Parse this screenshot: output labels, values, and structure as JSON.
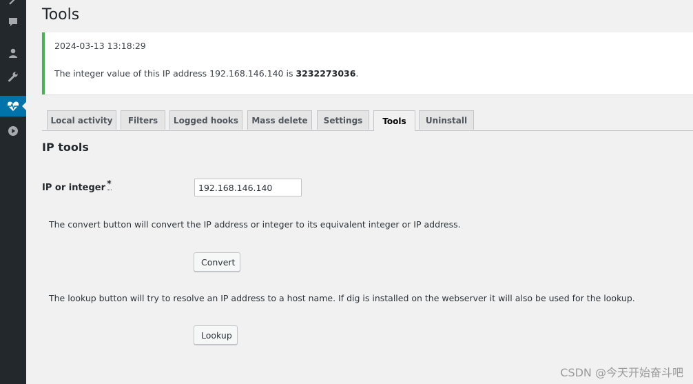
{
  "sidebar": {
    "icons": [
      "tools-icon",
      "comments-icon",
      "users-icon",
      "wrench-icon",
      "heartbeat-icon",
      "play-icon"
    ],
    "active_color": "#0073aa"
  },
  "page": {
    "title": "Tools"
  },
  "notice": {
    "timestamp": "2024-03-13 13:18:29",
    "message_prefix": "The integer value of this IP address 192.168.146.140 is ",
    "message_value": "3232273036",
    "message_suffix": ".",
    "border_color": "#46b450"
  },
  "tabs": [
    {
      "label": "Local activity",
      "active": false
    },
    {
      "label": "Filters",
      "active": false
    },
    {
      "label": "Logged hooks",
      "active": false
    },
    {
      "label": "Mass delete",
      "active": false
    },
    {
      "label": "Settings",
      "active": false
    },
    {
      "label": "Tools",
      "active": true
    },
    {
      "label": "Uninstall",
      "active": false
    }
  ],
  "ip_tools": {
    "section_title": "IP tools",
    "field_label": "IP or integer",
    "required_marker": "*",
    "field_value": "192.168.146.140",
    "convert_description": "The convert button will convert the IP address or integer to its equivalent integer or IP address.",
    "convert_button": "Convert",
    "lookup_description": "The lookup button will try to resolve an IP address to a host name. If dig is installed on the webserver it will also be used for the lookup.",
    "lookup_button": "Lookup"
  },
  "watermark": "CSDN @今天开始奋斗吧"
}
